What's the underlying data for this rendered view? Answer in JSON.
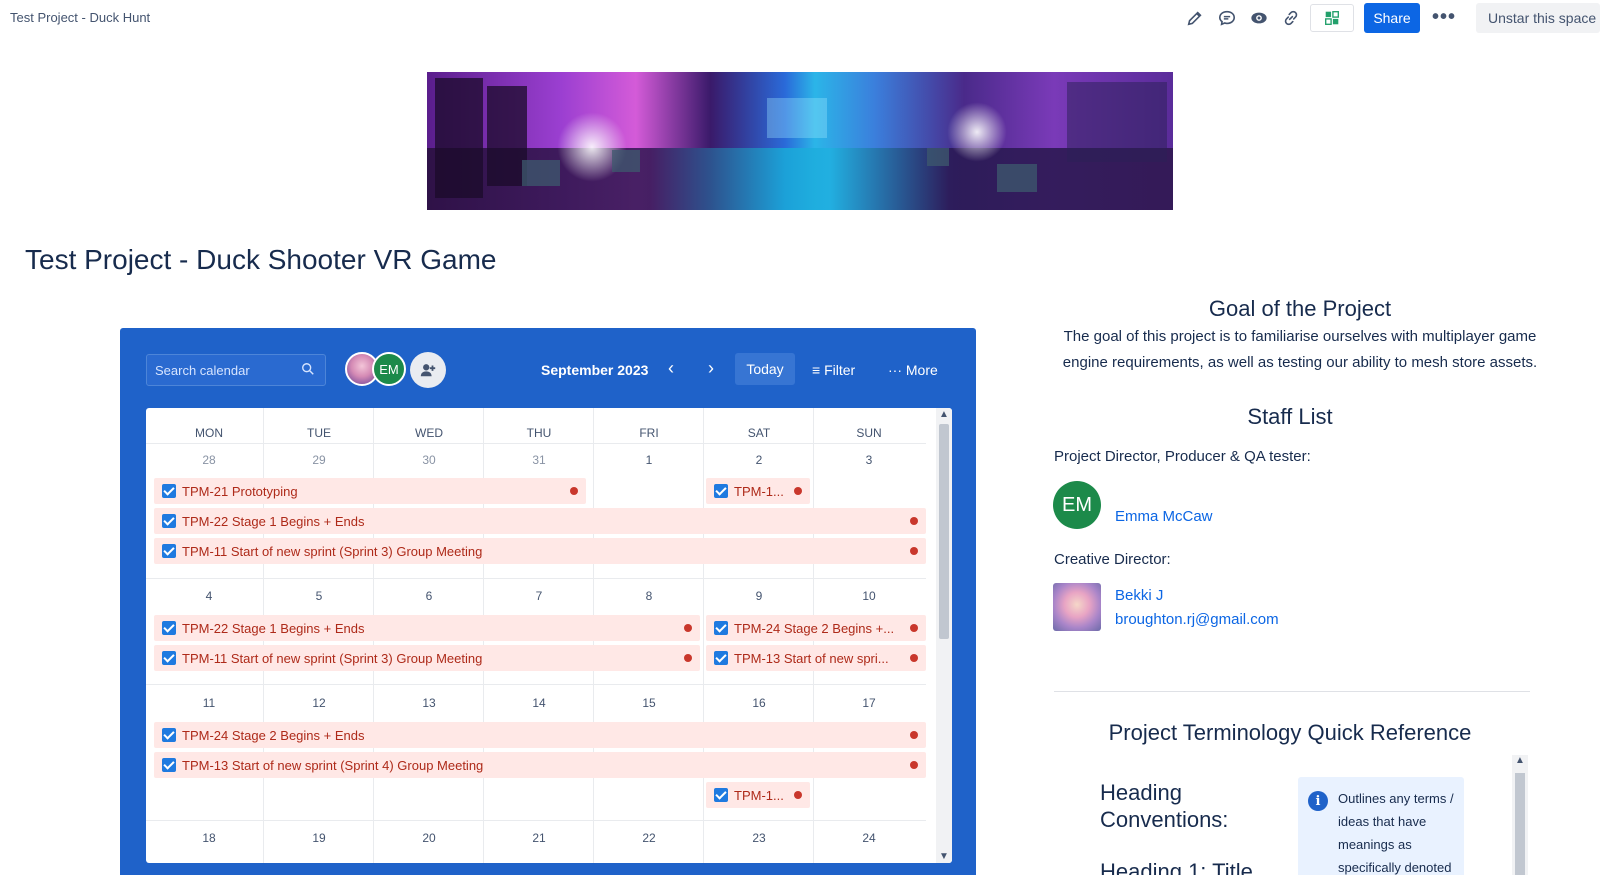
{
  "topbar": {
    "title": "Test Project - Duck Hunt",
    "share_label": "Share",
    "more_label": "•••",
    "unstar_label": "Unstar this space",
    "icons": [
      "pencil-icon",
      "comment-icon",
      "eye-icon",
      "link-icon",
      "app-icon"
    ]
  },
  "page": {
    "title": "Test Project - Duck Shooter VR Game"
  },
  "calendar": {
    "search_placeholder": "Search calendar",
    "avatar_em": "EM",
    "month": "September 2023",
    "prev": "‹",
    "next": "›",
    "today": "Today",
    "filter": "Filter",
    "more": "More",
    "day_headers": [
      "MON",
      "TUE",
      "WED",
      "THU",
      "FRI",
      "SAT",
      "SUN"
    ],
    "weeks": [
      [
        "28",
        "29",
        "30",
        "31",
        "1",
        "2",
        "3"
      ],
      [
        "4",
        "5",
        "6",
        "7",
        "8",
        "9",
        "10"
      ],
      [
        "11",
        "12",
        "13",
        "14",
        "15",
        "16",
        "17"
      ],
      [
        "18",
        "19",
        "20",
        "21",
        "22",
        "23",
        "24"
      ]
    ],
    "events": {
      "w1e1": "TPM-21 Prototyping",
      "w1e2": "TPM-1...",
      "w1e3": "TPM-22 Stage 1 Begins + Ends",
      "w1e4": "TPM-11 Start of new sprint (Sprint 3) Group Meeting",
      "w2e1": "TPM-22 Stage 1 Begins + Ends",
      "w2e2": "TPM-24 Stage 2 Begins +...",
      "w2e3": "TPM-11 Start of new sprint (Sprint 3) Group Meeting",
      "w2e4": "TPM-13 Start of new spri...",
      "w3e1": "TPM-24 Stage 2 Begins + Ends",
      "w3e2": "TPM-13 Start of new sprint (Sprint 4) Group Meeting",
      "w3e3": "TPM-1..."
    },
    "status_color": "#c9372c",
    "accent": "#1f62c9"
  },
  "goal": {
    "title": "Goal of the Project",
    "text": "The goal of this project is to familiarise ourselves with multiplayer game engine requirements, as well as testing our ability to mesh store assets."
  },
  "staff": {
    "title": "Staff List",
    "role1": "Project Director, Producer & QA tester:",
    "person1_initials": "EM",
    "person1_name": "Emma McCaw",
    "role2": "Creative Director:",
    "person2_name": "Bekki J",
    "person2_email": "broughton.rj@gmail.com"
  },
  "terminology": {
    "title": "Project Terminology Quick Reference",
    "heading_conventions": "Heading Conventions:",
    "heading_1": "Heading 1: Title",
    "info_text": "Outlines any terms / ideas that have meanings as specifically denoted"
  }
}
